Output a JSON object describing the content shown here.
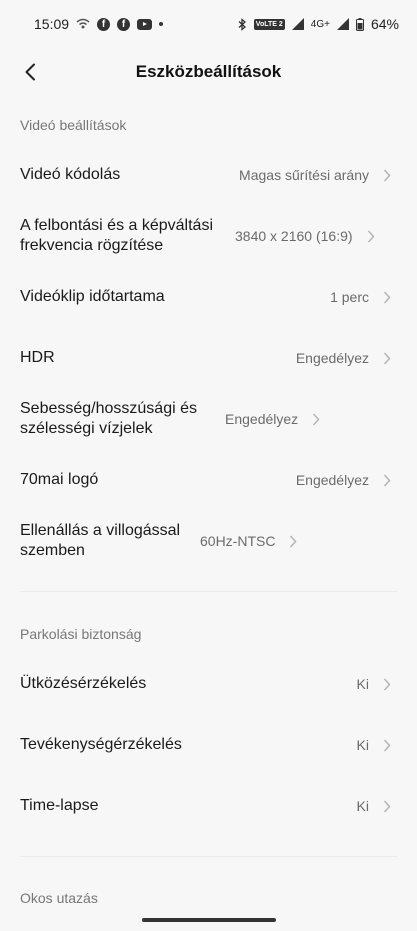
{
  "status_bar": {
    "time": "15:09",
    "volte_line1": "Vo",
    "volte_line2": "LTE 2",
    "network": "4G+",
    "battery": "64%"
  },
  "header": {
    "title": "Eszközbeállítások"
  },
  "sections": [
    {
      "label": "Videó beállítások",
      "rows": [
        {
          "label": "Videó kódolás",
          "value": "Magas sűrítési arány"
        },
        {
          "label": "A felbontási és a képváltási frekvencia rögzítése",
          "value": "3840 x 2160 (16:9)"
        },
        {
          "label": "Videóklip időtartama",
          "value": "1 perc"
        },
        {
          "label": "HDR",
          "value": "Engedélyez"
        },
        {
          "label": "Sebesség/hosszúsági és szélességi vízjelek",
          "value": "Engedélyez"
        },
        {
          "label": "70mai logó",
          "value": "Engedélyez"
        },
        {
          "label": "Ellenállás a villogással szemben",
          "value": "60Hz-NTSC"
        }
      ]
    },
    {
      "label": "Parkolási biztonság",
      "rows": [
        {
          "label": "Ütközésérzékelés",
          "value": "Ki"
        },
        {
          "label": "Tevékenységérzékelés",
          "value": "Ki"
        },
        {
          "label": "Time-lapse",
          "value": "Ki"
        }
      ]
    },
    {
      "label": "Okos utazás",
      "rows": []
    }
  ],
  "icons": {
    "back": "chevron-left-icon",
    "row_arrow": "chevron-right-icon"
  },
  "colors": {
    "background": "#f7f7f7",
    "primary_text": "#1a1a1a",
    "secondary_text": "#6b6b6b",
    "section_label": "#777777"
  }
}
